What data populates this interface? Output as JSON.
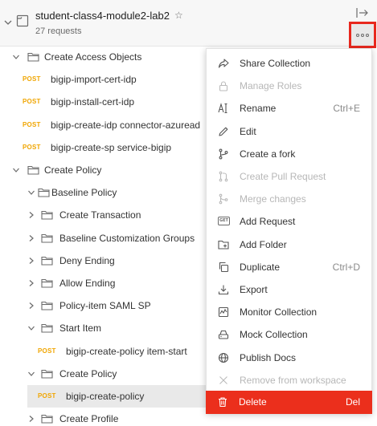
{
  "collection": {
    "name": "student-class4-module2-lab2",
    "request_count": "27 requests",
    "star_icon": "star-icon"
  },
  "tree": [
    {
      "type": "folder",
      "label": "Create Access Objects",
      "level": 0,
      "expanded": true
    },
    {
      "type": "request",
      "method": "POST",
      "label": "bigip-import-cert-idp",
      "level": 1
    },
    {
      "type": "request",
      "method": "POST",
      "label": "bigip-install-cert-idp",
      "level": 1
    },
    {
      "type": "request",
      "method": "POST",
      "label": "bigip-create-idp connector-azuread",
      "level": 1
    },
    {
      "type": "request",
      "method": "POST",
      "label": "bigip-create-sp service-bigip",
      "level": 1
    },
    {
      "type": "folder",
      "label": "Create Policy",
      "level": 0,
      "expanded": true
    },
    {
      "type": "folder",
      "label": "Baseline Policy",
      "level": 1,
      "expanded": true
    },
    {
      "type": "folder",
      "label": "Create Transaction",
      "level": 2,
      "expanded": false
    },
    {
      "type": "folder",
      "label": "Baseline Customization Groups",
      "level": 2,
      "expanded": false
    },
    {
      "type": "folder",
      "label": "Deny Ending",
      "level": 2,
      "expanded": false
    },
    {
      "type": "folder",
      "label": "Allow Ending",
      "level": 2,
      "expanded": false
    },
    {
      "type": "folder",
      "label": "Policy-item SAML SP",
      "level": 2,
      "expanded": false
    },
    {
      "type": "folder",
      "label": "Start Item",
      "level": 2,
      "expanded": true
    },
    {
      "type": "request",
      "method": "POST",
      "label": "bigip-create-policy item-start",
      "level": 3
    },
    {
      "type": "folder",
      "label": "Create Policy",
      "level": 2,
      "expanded": true
    },
    {
      "type": "request",
      "method": "POST",
      "label": "bigip-create-policy",
      "level": 3,
      "selected": true
    },
    {
      "type": "folder",
      "label": "Create Profile",
      "level": 2,
      "expanded": false
    }
  ],
  "menu": [
    {
      "label": "Share Collection",
      "icon": "share-icon",
      "shortcut": "",
      "disabled": false
    },
    {
      "label": "Manage Roles",
      "icon": "lock-icon",
      "shortcut": "",
      "disabled": true
    },
    {
      "label": "Rename",
      "icon": "rename-icon",
      "shortcut": "Ctrl+E",
      "disabled": false
    },
    {
      "label": "Edit",
      "icon": "pencil-icon",
      "shortcut": "",
      "disabled": false
    },
    {
      "label": "Create a fork",
      "icon": "fork-icon",
      "shortcut": "",
      "disabled": false
    },
    {
      "label": "Create Pull Request",
      "icon": "pull-request-icon",
      "shortcut": "",
      "disabled": true
    },
    {
      "label": "Merge changes",
      "icon": "merge-icon",
      "shortcut": "",
      "disabled": true
    },
    {
      "label": "Add Request",
      "icon": "get-request-icon",
      "shortcut": "",
      "disabled": false
    },
    {
      "label": "Add Folder",
      "icon": "add-folder-icon",
      "shortcut": "",
      "disabled": false
    },
    {
      "label": "Duplicate",
      "icon": "duplicate-icon",
      "shortcut": "Ctrl+D",
      "disabled": false
    },
    {
      "label": "Export",
      "icon": "export-icon",
      "shortcut": "",
      "disabled": false
    },
    {
      "label": "Monitor Collection",
      "icon": "monitor-icon",
      "shortcut": "",
      "disabled": false
    },
    {
      "label": "Mock Collection",
      "icon": "mock-server-icon",
      "shortcut": "",
      "disabled": false
    },
    {
      "label": "Publish Docs",
      "icon": "globe-icon",
      "shortcut": "",
      "disabled": false
    },
    {
      "label": "Remove from workspace",
      "icon": "close-icon",
      "shortcut": "",
      "disabled": true
    },
    {
      "label": "Delete",
      "icon": "trash-icon",
      "shortcut": "Del",
      "disabled": false,
      "danger": true
    }
  ],
  "get_badge_text": "GET",
  "colors": {
    "post_method": "#f0a500",
    "delete_bg": "#eb2f1c",
    "highlight_border": "#e8281e"
  }
}
